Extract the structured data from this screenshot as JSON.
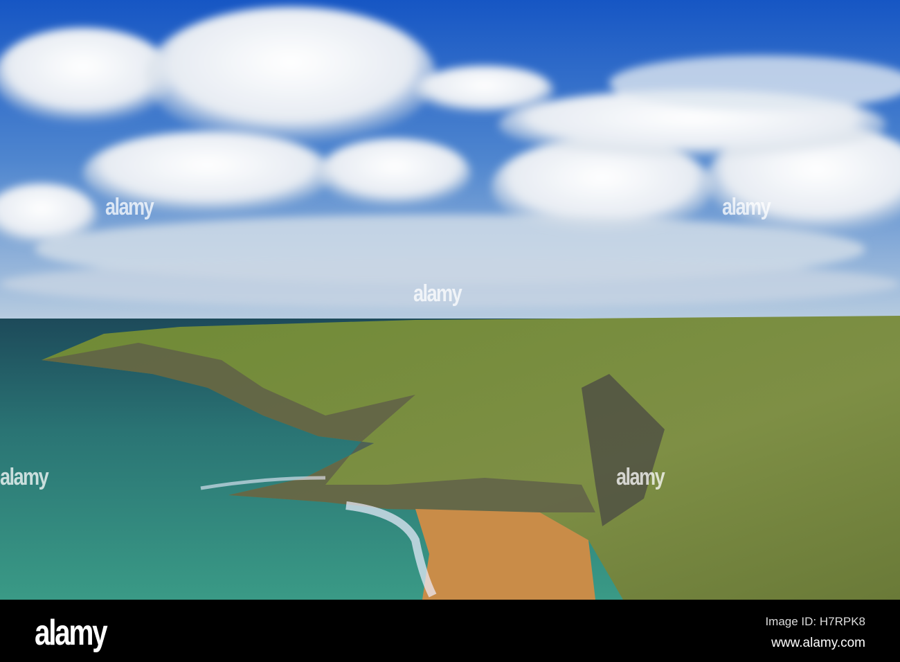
{
  "photo": {
    "subject": "Coastal cliffs with sandy cove under cloudy blue sky",
    "watermark": "alamy"
  },
  "footer": {
    "logo": "alamy",
    "image_id": "Image ID: H7RPK8",
    "website": "www.alamy.com"
  },
  "colors": {
    "sky": "#1f5fc0",
    "sea": "#2f7f78",
    "grass": "#7d9a3a",
    "sand": "#c98c48",
    "footer": "#000000"
  }
}
